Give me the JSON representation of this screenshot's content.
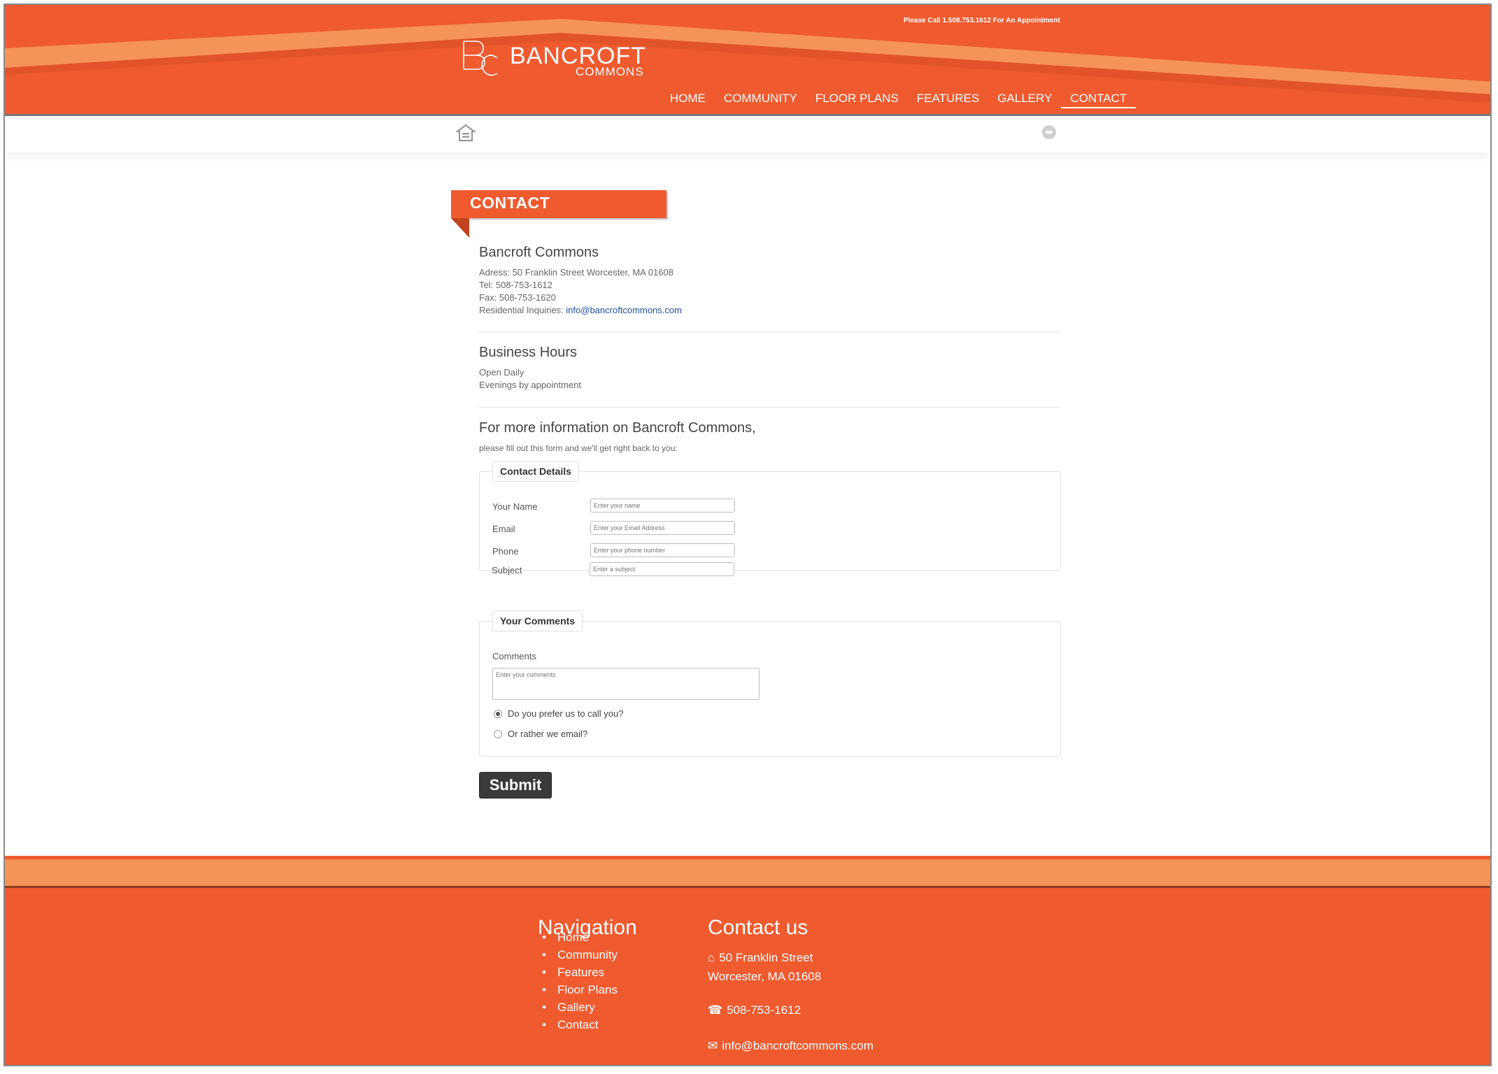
{
  "header": {
    "call_text": "Please Call 1.508.753.1612 For An Appointment",
    "logo_name": "BANCROFT",
    "logo_sub": "COMMONS",
    "nav": [
      "HOME",
      "COMMUNITY",
      "FLOOR PLANS",
      "FEATURES",
      "GALLERY",
      "CONTACT"
    ],
    "active_nav": "CONTACT"
  },
  "colors": {
    "brand_orange": "#ef5a2f",
    "light_orange": "#f59359",
    "button_dark": "#3a3a3a",
    "link_blue": "#1f4e9e"
  },
  "page": {
    "ribbon_title": "CONTACT",
    "company": {
      "name": "Bancroft Commons",
      "address": "Adress: 50 Franklin Street Worcester, MA 01608",
      "tel": "Tel: 508-753-1612",
      "fax": "Fax: 508-753-1620",
      "inquiries_label": "Residential Inquiries: ",
      "inquiries_email": "info@bancroftcommons.com"
    },
    "hours": {
      "title": "Business Hours",
      "line1": "Open Daily",
      "line2": "Evenings by appointment"
    },
    "more_info": {
      "title": "For more information on Bancroft Commons,",
      "subtitle": "please fill out this form and we'll get right back to you:"
    },
    "contact_details": {
      "legend": "Contact Details",
      "fields": [
        {
          "label": "Your Name",
          "placeholder": "Enter your name"
        },
        {
          "label": "Email",
          "placeholder": "Enter your Email Address"
        },
        {
          "label": "Phone",
          "placeholder": "Enter your phone number"
        },
        {
          "label": "Subject",
          "placeholder": "Enter a subject"
        }
      ]
    },
    "comments": {
      "legend": "Your Comments",
      "label": "Comments",
      "placeholder": "Enter your comments",
      "radio_call": "Do you prefer us to call you?",
      "radio_email": "Or rather we email?",
      "selected": "call"
    },
    "submit_label": "Submit"
  },
  "footer": {
    "nav_heading": "Navigation",
    "nav_items": [
      "Home",
      "Community",
      "Features",
      "Floor Plans",
      "Gallery",
      "Contact"
    ],
    "contact_heading": "Contact us",
    "address_line1": "50 Franklin Street",
    "address_line2": "Worcester, MA 01608",
    "phone": "508-753-1612",
    "email": "info@bancroftcommons.com",
    "icons": [
      "home-icon",
      "phone-icon",
      "envelope-icon"
    ]
  }
}
